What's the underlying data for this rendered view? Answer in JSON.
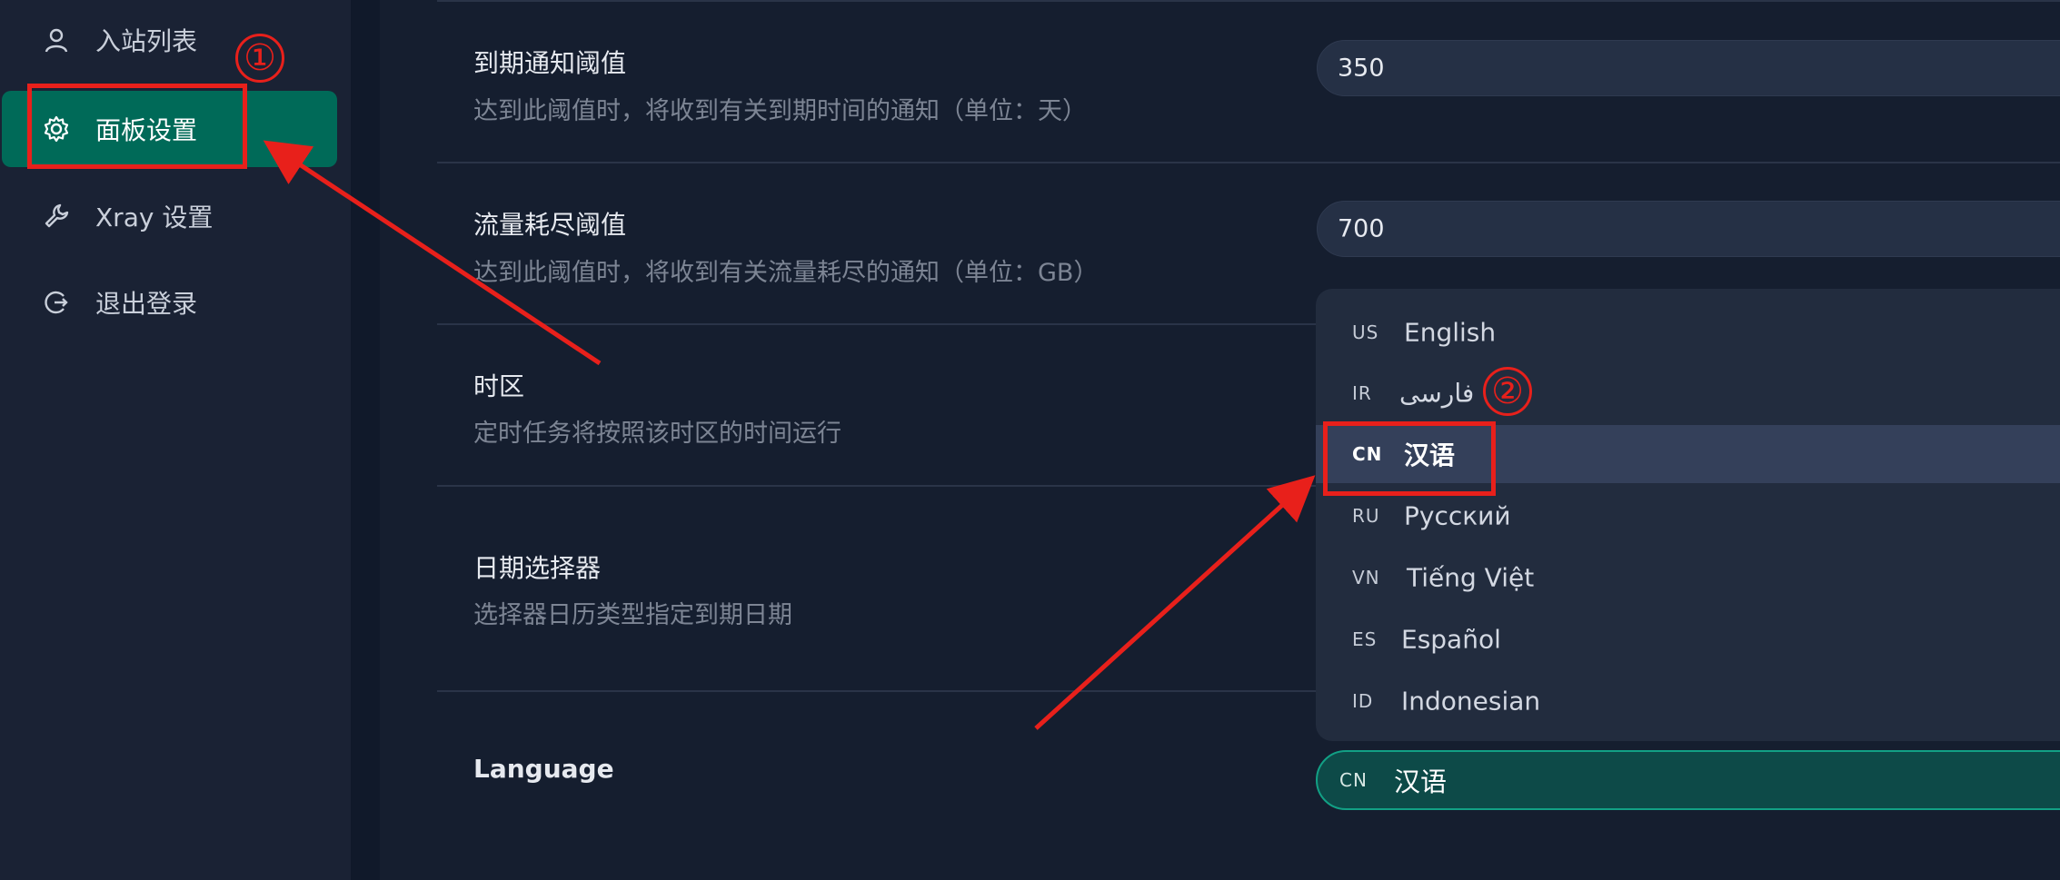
{
  "sidebar": {
    "items": [
      {
        "label": "入站列表",
        "icon": "user-icon"
      },
      {
        "label": "面板设置",
        "icon": "gear-icon",
        "active": true
      },
      {
        "label": "Xray 设置",
        "icon": "wrench-icon"
      },
      {
        "label": "退出登录",
        "icon": "logout-icon"
      }
    ]
  },
  "settings": {
    "expiry": {
      "title": "到期通知阈值",
      "desc": "达到此阈值时，将收到有关到期时间的通知（单位：天）",
      "value": "350"
    },
    "traffic": {
      "title": "流量耗尽阈值",
      "desc": "达到此阈值时，将收到有关流量耗尽的通知（单位：GB）",
      "value": "700"
    },
    "timezone": {
      "title": "时区",
      "desc": "定时任务将按照该时区的时间运行"
    },
    "datepicker": {
      "title": "日期选择器",
      "desc": "选择器日历类型指定到期日期"
    },
    "language": {
      "title": "Language",
      "selected_code": "CN",
      "selected_name": "汉语"
    }
  },
  "language_options": [
    {
      "code": "US",
      "name": "English"
    },
    {
      "code": "IR",
      "name": "فارسی"
    },
    {
      "code": "CN",
      "name": "汉语",
      "selected": true
    },
    {
      "code": "RU",
      "name": "Русский"
    },
    {
      "code": "VN",
      "name": "Tiếng Việt"
    },
    {
      "code": "ES",
      "name": "Español"
    },
    {
      "code": "ID",
      "name": "Indonesian"
    }
  ],
  "annotations": {
    "step1": "①",
    "step2": "②",
    "color": "#e8201b"
  },
  "colors": {
    "background": "#151e2f",
    "sidebar": "#1a2234",
    "accent": "#006a58",
    "select_border": "#12a085"
  }
}
